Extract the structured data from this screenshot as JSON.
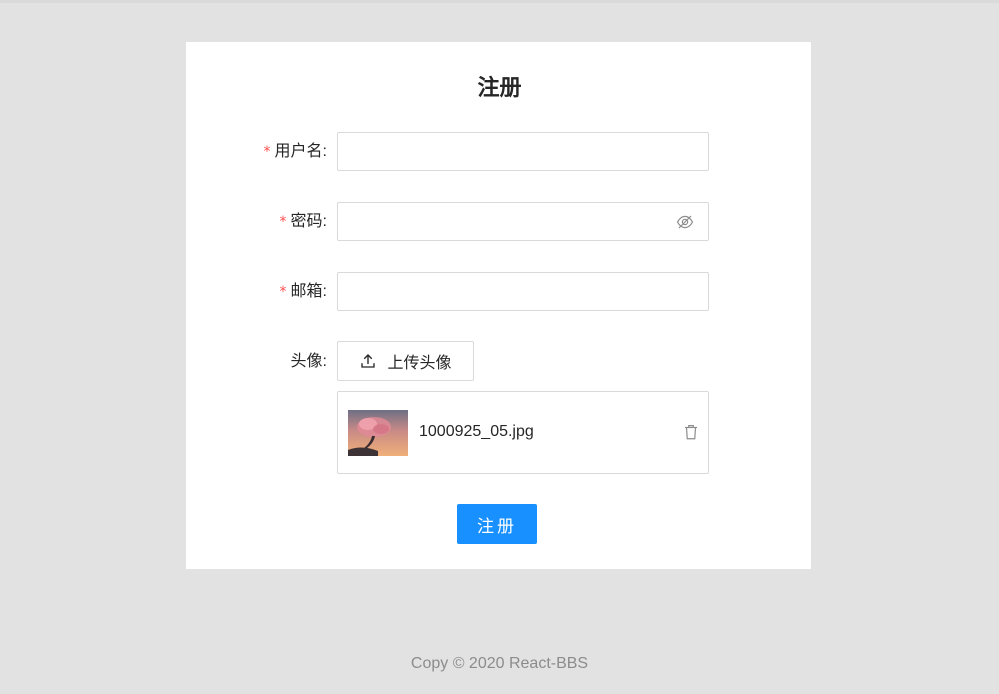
{
  "form": {
    "title": "注册",
    "fields": {
      "username": {
        "label": "用户名:",
        "required": true,
        "value": ""
      },
      "password": {
        "label": "密码:",
        "required": true,
        "value": ""
      },
      "email": {
        "label": "邮箱:",
        "required": true,
        "value": ""
      },
      "avatar": {
        "label": "头像:",
        "required": false
      }
    },
    "required_mark": "*",
    "upload_button_label": "上传头像",
    "uploaded_file": {
      "name": "1000925_05.jpg"
    },
    "submit_label": "注册"
  },
  "icons": {
    "password_toggle": "eye-invisible-icon",
    "upload": "upload-icon",
    "delete": "trash-icon"
  },
  "colors": {
    "background": "#e2e2e2",
    "card": "#ffffff",
    "primary": "#1890ff",
    "required": "#ff4d4f",
    "border": "#d9d9d9",
    "footer_text": "#8c8c8c"
  },
  "footer": {
    "copyright": "Copy © 2020 React-BBS"
  }
}
